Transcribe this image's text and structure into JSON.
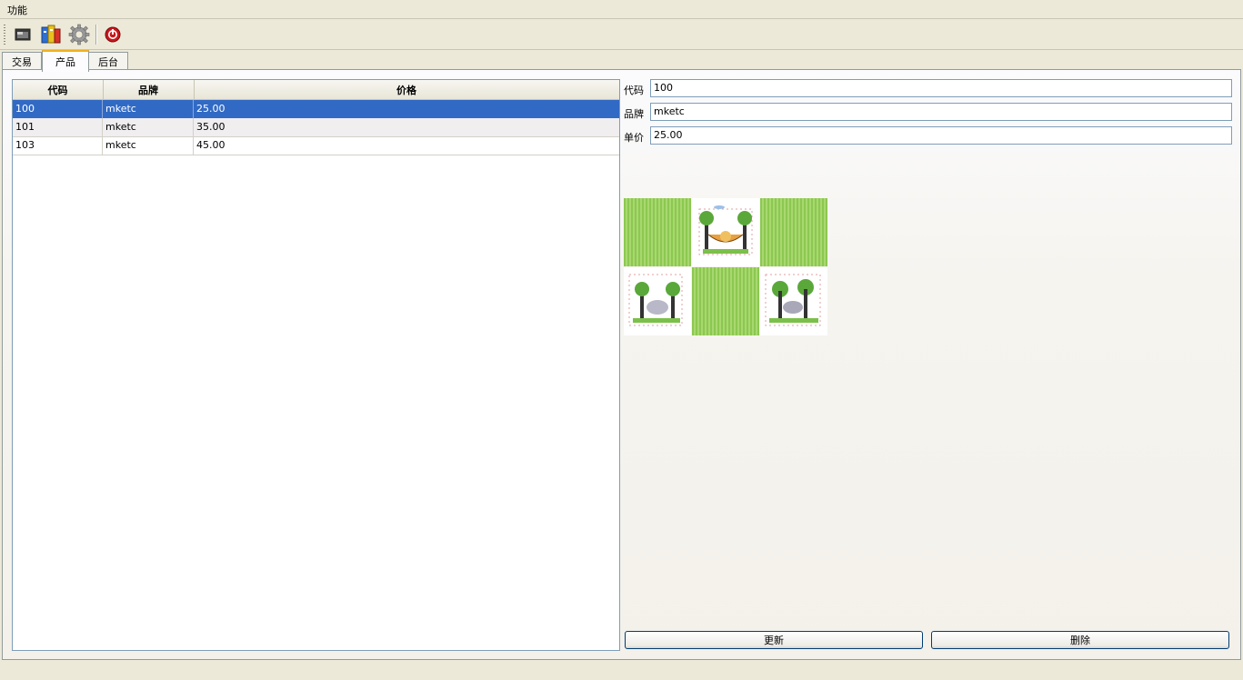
{
  "menu": {
    "items": [
      {
        "label": "功能"
      }
    ]
  },
  "toolbar": {
    "buttons": [
      {
        "icon": "window-icon"
      },
      {
        "icon": "books-icon"
      },
      {
        "icon": "gear-icon"
      },
      {
        "icon": "power-icon"
      }
    ]
  },
  "tabs": [
    {
      "label": "交易",
      "active": false
    },
    {
      "label": "产品",
      "active": true
    },
    {
      "label": "后台",
      "active": false
    }
  ],
  "table": {
    "columns": [
      "代码",
      "品牌",
      "价格"
    ],
    "rows": [
      [
        "100",
        "mketc",
        "25.00"
      ],
      [
        "101",
        "mketc",
        "35.00"
      ],
      [
        "103",
        "mketc",
        "45.00"
      ]
    ],
    "selected_row": 0
  },
  "form": {
    "code_label": "代码",
    "code_value": "100",
    "brand_label": "品牌",
    "brand_value": "mketc",
    "price_label": "单价",
    "price_value": "25.00"
  },
  "buttons": {
    "update_label": "更新",
    "delete_label": "删除"
  },
  "colors": {
    "selection": "#316ac5",
    "tab_accent": "#f2b01e",
    "button_border": "#003c74"
  }
}
